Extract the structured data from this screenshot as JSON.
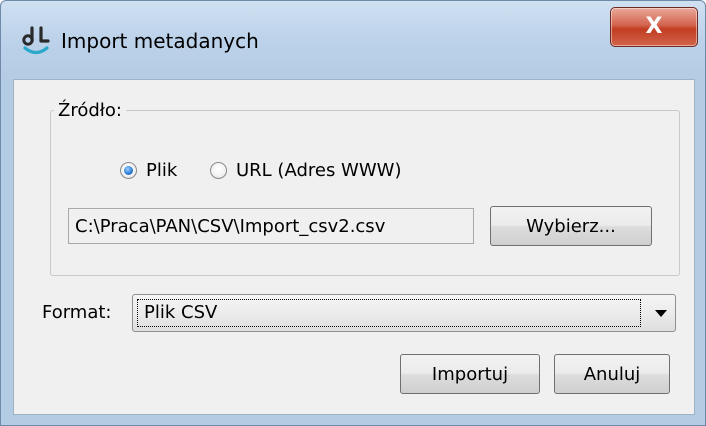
{
  "window": {
    "title": "Import metadanych",
    "close_label": "X"
  },
  "source": {
    "group_label": "Źródło:",
    "options": [
      {
        "label": "Plik",
        "checked": true
      },
      {
        "label": "URL (Adres WWW)",
        "checked": false
      }
    ],
    "path_value": "C:\\Praca\\PAN\\CSV\\Import_csv2.csv",
    "browse_label": "Wybierz..."
  },
  "format": {
    "label": "Format:",
    "selected": "Plik CSV"
  },
  "buttons": {
    "import_label": "Importuj",
    "cancel_label": "Anuluj"
  },
  "icons": {
    "app": "dl-logo-icon",
    "dropdown": "chevron-down-icon"
  },
  "colors": {
    "title_bar": "#bcd2ea",
    "close_button": "#c94a30",
    "client_background": "#f0f0f0",
    "radio_selected": "#2f7fd6"
  }
}
